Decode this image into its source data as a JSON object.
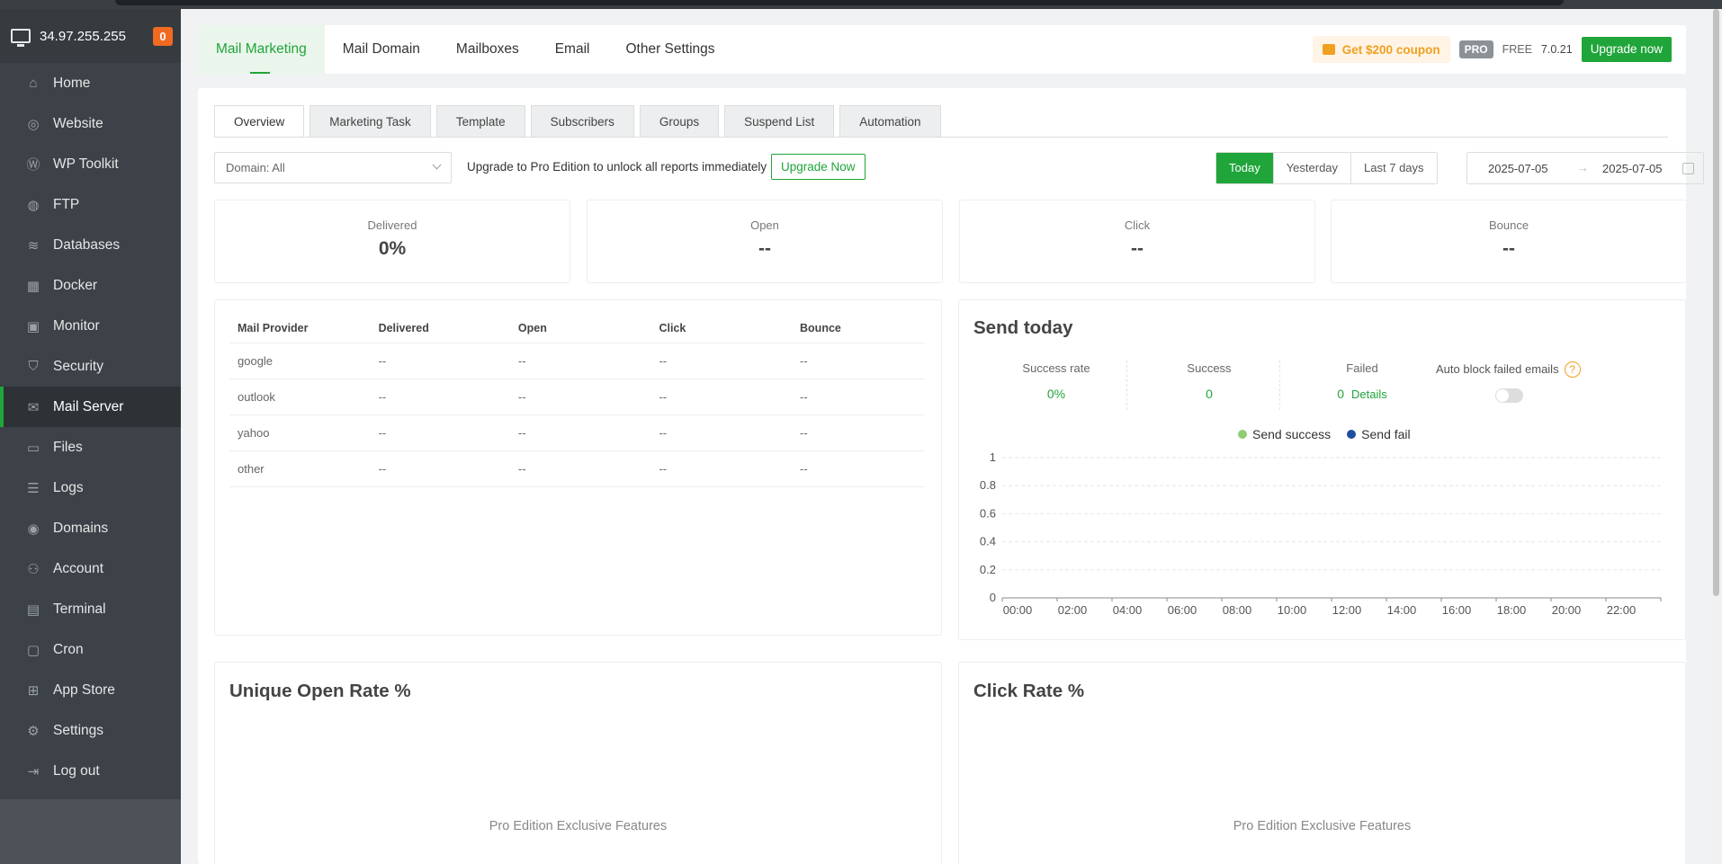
{
  "sidebar": {
    "ip": "34.97.255.255",
    "badge": "0",
    "items": [
      {
        "label": "Home",
        "icon": "home-icon",
        "glyph": "⌂"
      },
      {
        "label": "Website",
        "icon": "globe-icon",
        "glyph": "◎"
      },
      {
        "label": "WP Toolkit",
        "icon": "wordpress-icon",
        "glyph": "Ⓦ"
      },
      {
        "label": "FTP",
        "icon": "ftp-icon",
        "glyph": "◍"
      },
      {
        "label": "Databases",
        "icon": "database-icon",
        "glyph": "≋"
      },
      {
        "label": "Docker",
        "icon": "docker-icon",
        "glyph": "▦"
      },
      {
        "label": "Monitor",
        "icon": "monitor-icon",
        "glyph": "▣"
      },
      {
        "label": "Security",
        "icon": "shield-icon",
        "glyph": "⛉"
      },
      {
        "label": "Mail Server",
        "icon": "mail-icon",
        "glyph": "✉"
      },
      {
        "label": "Files",
        "icon": "folder-icon",
        "glyph": "▭"
      },
      {
        "label": "Logs",
        "icon": "log-icon",
        "glyph": "☰"
      },
      {
        "label": "Domains",
        "icon": "domain-icon",
        "glyph": "◉"
      },
      {
        "label": "Account",
        "icon": "user-icon",
        "glyph": "⚇"
      },
      {
        "label": "Terminal",
        "icon": "terminal-icon",
        "glyph": "▤"
      },
      {
        "label": "Cron",
        "icon": "cron-icon",
        "glyph": "▢"
      },
      {
        "label": "App Store",
        "icon": "app-store-icon",
        "glyph": "⊞"
      },
      {
        "label": "Settings",
        "icon": "gear-icon",
        "glyph": "⚙"
      },
      {
        "label": "Log out",
        "icon": "logout-icon",
        "glyph": "⇥"
      }
    ],
    "active_index": 8
  },
  "topnav": {
    "tabs": [
      "Mail Marketing",
      "Mail Domain",
      "Mailboxes",
      "Email",
      "Other Settings"
    ],
    "coupon": "Get $200 coupon",
    "pro": "PRO",
    "free": "FREE",
    "version": "7.0.21",
    "upgrade": "Upgrade now"
  },
  "subtabs": [
    "Overview",
    "Marketing Task",
    "Template",
    "Subscribers",
    "Groups",
    "Suspend List",
    "Automation"
  ],
  "filter": {
    "domain": "Domain: All",
    "upgrade_text": "Upgrade to Pro Edition to unlock all reports immediately",
    "upgrade_now": "Upgrade Now",
    "days": [
      "Today",
      "Yesterday",
      "Last 7 days"
    ],
    "date_start": "2025-07-05",
    "date_end": "2025-07-05"
  },
  "stats": [
    {
      "label": "Delivered",
      "value": "0%"
    },
    {
      "label": "Open",
      "value": "--"
    },
    {
      "label": "Click",
      "value": "--"
    },
    {
      "label": "Bounce",
      "value": "--"
    }
  ],
  "providers": {
    "headers": [
      "Mail Provider",
      "Delivered",
      "Open",
      "Click",
      "Bounce"
    ],
    "rows": [
      [
        "google",
        "--",
        "--",
        "--",
        "--"
      ],
      [
        "outlook",
        "--",
        "--",
        "--",
        "--"
      ],
      [
        "yahoo",
        "--",
        "--",
        "--",
        "--"
      ],
      [
        "other",
        "--",
        "--",
        "--",
        "--"
      ]
    ]
  },
  "send_today": {
    "title": "Send today",
    "success_rate_label": "Success rate",
    "success_rate": "0%",
    "success_label": "Success",
    "success": "0",
    "failed_label": "Failed",
    "failed": "0",
    "details": "Details",
    "auto_block": "Auto block failed emails",
    "auto_block_enabled": false
  },
  "chart_data": {
    "type": "line",
    "x": [
      "00:00",
      "02:00",
      "04:00",
      "06:00",
      "08:00",
      "10:00",
      "12:00",
      "14:00",
      "16:00",
      "18:00",
      "20:00",
      "22:00"
    ],
    "y_ticks": [
      "0",
      "0.2",
      "0.4",
      "0.6",
      "0.8",
      "1"
    ],
    "ylim": [
      0,
      1
    ],
    "grid": true,
    "legend_position": "top",
    "series": [
      {
        "name": "Send success",
        "color": "#91cc75",
        "values": []
      },
      {
        "name": "Send fail",
        "color": "#1f4e9c",
        "values": []
      }
    ]
  },
  "rates": [
    {
      "title": "Unique Open Rate %",
      "note": "Pro Edition Exclusive Features"
    },
    {
      "title": "Click Rate %",
      "note": "Pro Edition Exclusive Features"
    }
  ],
  "colors": {
    "accent": "#20a53a",
    "warning": "#f0a020",
    "badge": "#f06a21"
  }
}
